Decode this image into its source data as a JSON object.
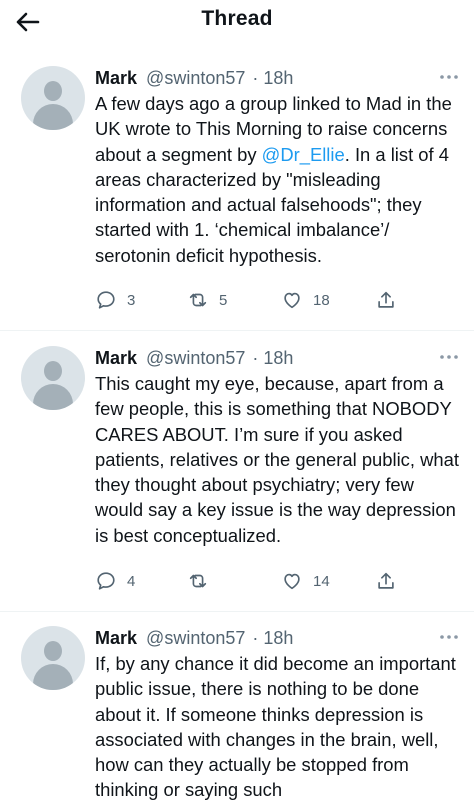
{
  "header": {
    "title": "Thread"
  },
  "tweets": [
    {
      "name": "Mark",
      "handle": "@swinton57",
      "time": "· 18h",
      "text_before": "A few days ago a group linked to Mad in the UK wrote to This Morning to raise concerns about a segment by ",
      "mention": "@Dr_Ellie",
      "text_after": ". In a list of 4 areas characterized by \"misleading information and actual falsehoods\"; they started with  1. ‘chemical imbalance’/ serotonin deficit hypothesis.",
      "replies": "3",
      "retweets": "5",
      "likes": "18"
    },
    {
      "name": "Mark",
      "handle": "@swinton57",
      "time": "· 18h",
      "text": "This caught my eye, because, apart from a few people, this is something that NOBODY CARES ABOUT. I’m sure if you asked patients, relatives or the general public, what they thought about psychiatry; very few would say a key issue is the way depression is best conceptualized.",
      "replies": "4",
      "retweets": "",
      "likes": "14"
    },
    {
      "name": "Mark",
      "handle": "@swinton57",
      "time": "· 18h",
      "text": "If, by any chance it did become an important public issue, there is nothing to be done about it. If someone thinks depression is associated with changes in the brain, well, how can they actually be stopped from thinking or saying such"
    }
  ],
  "icons": {
    "back": "arrow-left-icon",
    "more": "more-dots-icon",
    "reply": "reply-bubble-icon",
    "retweet": "retweet-icon",
    "like": "heart-icon",
    "share": "share-icon"
  },
  "colors": {
    "text": "#0f1419",
    "secondary": "#536471",
    "link": "#1d9bf0",
    "avatar_bg": "#dbe3e8",
    "avatar_fg": "#a4b0b8"
  }
}
